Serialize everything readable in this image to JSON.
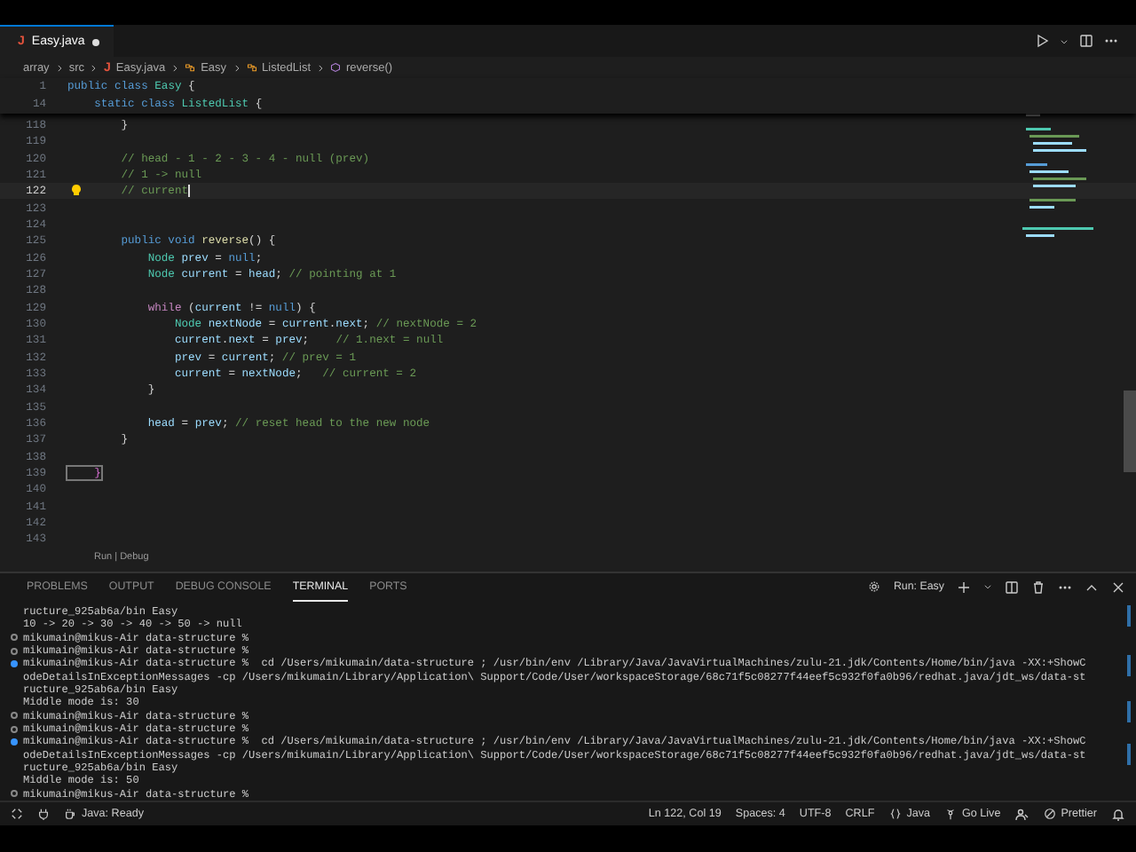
{
  "editor_tabs": [
    {
      "icon": "J",
      "label": "Easy.java",
      "selected": true,
      "modified": true
    }
  ],
  "breadcrumb": [
    {
      "kind": "folder",
      "label": "array"
    },
    {
      "kind": "folder",
      "label": "src"
    },
    {
      "kind": "file",
      "icon": "J",
      "label": "Easy.java"
    },
    {
      "kind": "class",
      "label": "Easy"
    },
    {
      "kind": "class",
      "label": "ListedList"
    },
    {
      "kind": "method",
      "label": "reverse()"
    }
  ],
  "sticky_lines": [
    {
      "number": "1",
      "tokens": [
        {
          "kind": "keyword",
          "text": "public"
        },
        {
          "kind": "keyword",
          "text": " class"
        },
        {
          "kind": "type",
          "text": " Easy"
        },
        {
          "kind": "plain",
          "text": " {"
        }
      ]
    },
    {
      "number": "14",
      "tokens": [
        {
          "kind": "keyword",
          "text": "    static"
        },
        {
          "kind": "keyword",
          "text": " class"
        },
        {
          "kind": "type",
          "text": " ListedList"
        },
        {
          "kind": "plain",
          "text": " {"
        }
      ]
    }
  ],
  "code_lines": [
    {
      "number": "118",
      "current": false,
      "tokens": [
        {
          "kind": "plain",
          "text": "        }"
        }
      ]
    },
    {
      "number": "119",
      "current": false
    },
    {
      "number": "120",
      "current": false,
      "tokens": [
        {
          "kind": "comment",
          "text": "        // head - 1 - 2 - 3 - 4 - null (prev)"
        }
      ]
    },
    {
      "number": "121",
      "current": false,
      "tokens": [
        {
          "kind": "comment",
          "text": "        // 1 -> null"
        }
      ]
    },
    {
      "number": "122",
      "current": true,
      "tokens": [
        {
          "kind": "comment",
          "text": "        // current"
        }
      ]
    },
    {
      "number": "123",
      "current": false
    },
    {
      "number": "124",
      "current": false
    },
    {
      "number": "125",
      "current": false,
      "tokens": [
        {
          "kind": "keyword",
          "text": "        public"
        },
        {
          "kind": "keyword",
          "text": " void"
        },
        {
          "kind": "function",
          "text": " reverse"
        },
        {
          "kind": "plain",
          "text": "() {"
        }
      ]
    },
    {
      "number": "126",
      "current": false,
      "tokens": [
        {
          "kind": "type",
          "text": "            Node"
        },
        {
          "kind": "variable",
          "text": " prev"
        },
        {
          "kind": "plain",
          "text": " = "
        },
        {
          "kind": "keyword",
          "text": "null"
        },
        {
          "kind": "plain",
          "text": ";"
        }
      ]
    },
    {
      "number": "127",
      "current": false,
      "tokens": [
        {
          "kind": "type",
          "text": "            Node"
        },
        {
          "kind": "variable",
          "text": " current"
        },
        {
          "kind": "plain",
          "text": " = "
        },
        {
          "kind": "variable",
          "text": "head"
        },
        {
          "kind": "plain",
          "text": ";"
        },
        {
          "kind": "comment",
          "text": " // pointing at 1"
        }
      ]
    },
    {
      "number": "128",
      "current": false
    },
    {
      "number": "129",
      "current": false,
      "tokens": [
        {
          "kind": "control",
          "text": "            while"
        },
        {
          "kind": "plain",
          "text": " ("
        },
        {
          "kind": "variable",
          "text": "current"
        },
        {
          "kind": "plain",
          "text": " != "
        },
        {
          "kind": "keyword",
          "text": "null"
        },
        {
          "kind": "plain",
          "text": ") {"
        }
      ]
    },
    {
      "number": "130",
      "current": false,
      "tokens": [
        {
          "kind": "type",
          "text": "                Node"
        },
        {
          "kind": "variable",
          "text": " nextNode"
        },
        {
          "kind": "plain",
          "text": " = "
        },
        {
          "kind": "variable",
          "text": "current"
        },
        {
          "kind": "plain",
          "text": "."
        },
        {
          "kind": "variable",
          "text": "next"
        },
        {
          "kind": "plain",
          "text": ";"
        },
        {
          "kind": "comment",
          "text": " // nextNode = 2"
        }
      ]
    },
    {
      "number": "131",
      "current": false,
      "tokens": [
        {
          "kind": "variable",
          "text": "                current"
        },
        {
          "kind": "plain",
          "text": "."
        },
        {
          "kind": "variable",
          "text": "next"
        },
        {
          "kind": "plain",
          "text": " = "
        },
        {
          "kind": "variable",
          "text": "prev"
        },
        {
          "kind": "plain",
          "text": ";"
        },
        {
          "kind": "comment",
          "text": "    // 1.next = null"
        }
      ]
    },
    {
      "number": "132",
      "current": false,
      "tokens": [
        {
          "kind": "variable",
          "text": "                prev"
        },
        {
          "kind": "plain",
          "text": " = "
        },
        {
          "kind": "variable",
          "text": "current"
        },
        {
          "kind": "plain",
          "text": ";"
        },
        {
          "kind": "comment",
          "text": " // prev = 1"
        }
      ]
    },
    {
      "number": "133",
      "current": false,
      "tokens": [
        {
          "kind": "variable",
          "text": "                current"
        },
        {
          "kind": "plain",
          "text": " = "
        },
        {
          "kind": "variable",
          "text": "nextNode"
        },
        {
          "kind": "plain",
          "text": ";"
        },
        {
          "kind": "comment",
          "text": "   // current = 2"
        }
      ]
    },
    {
      "number": "134",
      "current": false,
      "tokens": [
        {
          "kind": "plain",
          "text": "            }"
        }
      ]
    },
    {
      "number": "135",
      "current": false
    },
    {
      "number": "136",
      "current": false,
      "tokens": [
        {
          "kind": "variable",
          "text": "            head"
        },
        {
          "kind": "plain",
          "text": " = "
        },
        {
          "kind": "variable",
          "text": "prev"
        },
        {
          "kind": "plain",
          "text": ";"
        },
        {
          "kind": "comment",
          "text": " // reset head to the new node"
        }
      ]
    },
    {
      "number": "137",
      "current": false,
      "tokens": [
        {
          "kind": "plain",
          "text": "        }"
        }
      ]
    },
    {
      "number": "138",
      "current": false
    },
    {
      "number": "139",
      "current": false,
      "tokens": [
        {
          "kind": "bracket",
          "text": "    }"
        }
      ]
    },
    {
      "number": "140",
      "current": false
    },
    {
      "number": "141",
      "current": false
    },
    {
      "number": "142",
      "current": false
    },
    {
      "number": "143",
      "current": false
    }
  ],
  "codelens": "Run | Debug",
  "panel_tabs": [
    {
      "label": "PROBLEMS",
      "selected": false
    },
    {
      "label": "OUTPUT",
      "selected": false
    },
    {
      "label": "DEBUG CONSOLE",
      "selected": false
    },
    {
      "label": "TERMINAL",
      "selected": true
    },
    {
      "label": "PORTS",
      "selected": false
    }
  ],
  "terminal_name": "Run: Easy",
  "terminal_lines": [
    {
      "kind": "output",
      "text": "ructure_925ab6a/bin Easy"
    },
    {
      "kind": "output",
      "text": "10 -> 20 -> 30 -> 40 -> 50 -> null"
    },
    {
      "kind": "prompt",
      "text": "mikumain@mikus-Air data-structure %"
    },
    {
      "kind": "prompt",
      "text": "mikumain@mikus-Air data-structure %"
    },
    {
      "kind": "command",
      "text": "mikumain@mikus-Air data-structure %  cd /Users/mikumain/data-structure ; /usr/bin/env /Library/Java/JavaVirtualMachines/zulu-21.jdk/Contents/Home/bin/java -XX:+ShowC"
    },
    {
      "kind": "output",
      "text": "odeDetailsInExceptionMessages -cp /Users/mikumain/Library/Application\\ Support/Code/User/workspaceStorage/68c71f5c08277f44eef5c932f0fa0b96/redhat.java/jdt_ws/data-st"
    },
    {
      "kind": "output",
      "text": "ructure_925ab6a/bin Easy"
    },
    {
      "kind": "output",
      "text": "Middle mode is: 30"
    },
    {
      "kind": "prompt",
      "text": "mikumain@mikus-Air data-structure %"
    },
    {
      "kind": "prompt",
      "text": "mikumain@mikus-Air data-structure %"
    },
    {
      "kind": "command",
      "text": "mikumain@mikus-Air data-structure %  cd /Users/mikumain/data-structure ; /usr/bin/env /Library/Java/JavaVirtualMachines/zulu-21.jdk/Contents/Home/bin/java -XX:+ShowC"
    },
    {
      "kind": "output",
      "text": "odeDetailsInExceptionMessages -cp /Users/mikumain/Library/Application\\ Support/Code/User/workspaceStorage/68c71f5c08277f44eef5c932f0fa0b96/redhat.java/jdt_ws/data-st"
    },
    {
      "kind": "output",
      "text": "ructure_925ab6a/bin Easy"
    },
    {
      "kind": "output",
      "text": "Middle mode is: 50"
    },
    {
      "kind": "prompt",
      "text": "mikumain@mikus-Air data-structure %"
    }
  ],
  "status_bar": {
    "left": [
      {
        "kind": "java",
        "label": "Java: Ready"
      }
    ],
    "right": [
      {
        "kind": "text",
        "label": "Ln 122, Col 19"
      },
      {
        "kind": "text",
        "label": "Spaces: 4"
      },
      {
        "kind": "text",
        "label": "UTF-8"
      },
      {
        "kind": "text",
        "label": "CRLF"
      },
      {
        "kind": "braces",
        "label": "Java"
      },
      {
        "kind": "live",
        "label": "Go Live"
      },
      {
        "kind": "person"
      },
      {
        "kind": "prettier",
        "label": "Prettier"
      },
      {
        "kind": "bell"
      }
    ]
  }
}
